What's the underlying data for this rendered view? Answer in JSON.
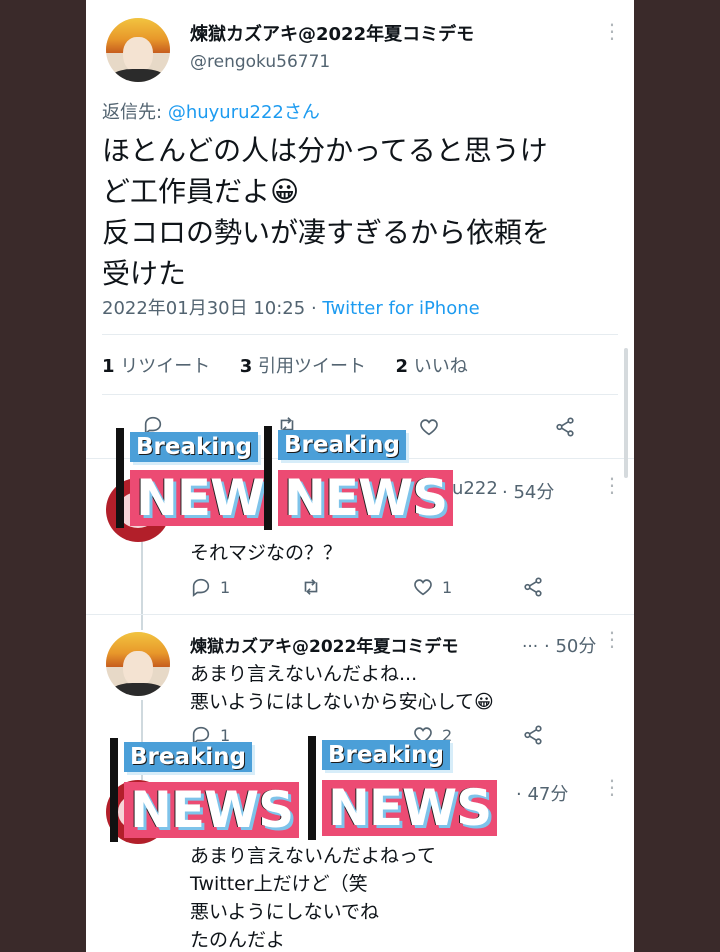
{
  "main_tweet": {
    "display_name": "煉獄カズアキ@2022年夏コミデモ",
    "handle": "@rengoku56771",
    "reply_to_label": "返信先:",
    "reply_to_handle": "@huyuru222さん",
    "body_lines": [
      "ほとんどの人は分かってると思うけ",
      "ど工作員だよ😀",
      "反コロの勢いが凄すぎるから依頼を",
      "受けた"
    ],
    "timestamp": "2022年01月30日 10:25",
    "separator": "·",
    "client": "Twitter for iPhone",
    "stats": {
      "retweets_count": "1",
      "retweets_label": "リツイート",
      "quotes_count": "3",
      "quotes_label": "引用ツイート",
      "likes_count": "2",
      "likes_label": "いいね"
    }
  },
  "replies": [
    {
      "name_partial": "u222",
      "time": "· 54分",
      "body_lines": [
        "それマジなの？？"
      ],
      "reply_count": "1",
      "retweet_count": "",
      "like_count": "1"
    },
    {
      "display_name": "煉獄カズアキ@2022年夏コミデモ",
      "ellipsis": "...",
      "time": "· 50分",
      "body_lines": [
        "あまり言えないんだよね...",
        "悪いようにはしないから安心して😀"
      ],
      "reply_count": "1",
      "like_count": "2"
    },
    {
      "time": "· 47分",
      "body_lines": [
        "あまり言えないんだよねって",
        "Twitter上だけど（笑",
        "悪いようにしないでね",
        "たのんだよ"
      ]
    }
  ],
  "overlays": [
    {
      "small": "Breaking",
      "big": "NEW"
    },
    {
      "small": "Breaking",
      "big": "NEWS"
    },
    {
      "small": "Breaking",
      "big": "NEWS"
    },
    {
      "small": "Breaking",
      "big": "NEWS"
    }
  ],
  "colors": {
    "accent": "#1d9bf0",
    "overlay_pink": "#ec4b73",
    "overlay_blue": "#4b9fd8"
  }
}
